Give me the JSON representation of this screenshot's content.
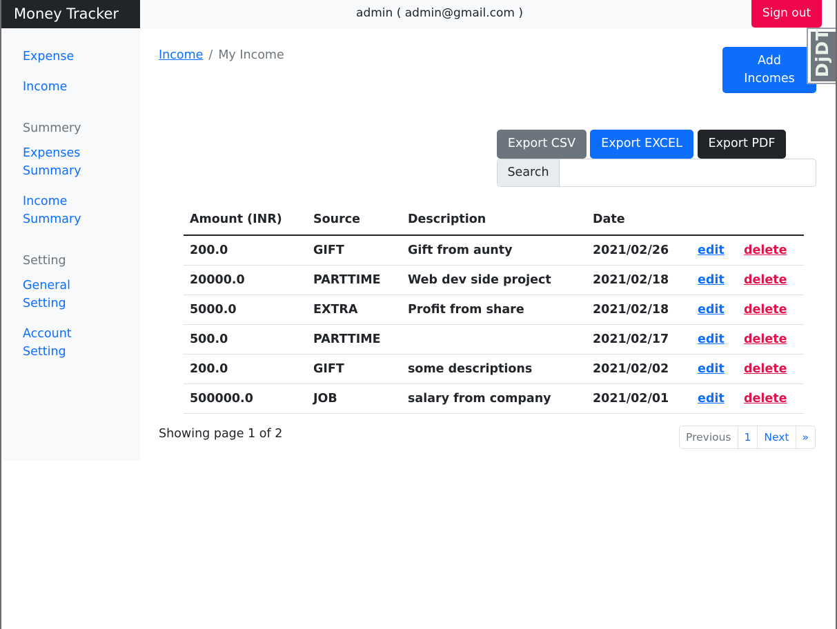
{
  "app": {
    "brand": "Money Tracker"
  },
  "header": {
    "user": "admin ( admin@gmail.com )",
    "signout_label": "Sign out"
  },
  "sidebar": {
    "expense": "Expense",
    "income": "Income",
    "summery_heading": "Summery",
    "expenses_summary_line1": "Expenses",
    "expenses_summary_line2": "Summary",
    "income_summary_line1": "Income",
    "income_summary_line2": "Summary",
    "setting_heading": "Setting",
    "general_setting_line1": "General",
    "general_setting_line2": "Setting",
    "account_setting_line1": "Account",
    "account_setting_line2": "Setting"
  },
  "breadcrumb": {
    "link": "Income",
    "separator": "/",
    "current": "My Income"
  },
  "toolbar": {
    "add_line1": "Add",
    "add_line2": "Incomes",
    "export_csv": "Export CSV",
    "export_excel": "Export EXCEL",
    "export_pdf": "Export PDF"
  },
  "search": {
    "label": "Search",
    "value": "",
    "placeholder": ""
  },
  "table": {
    "headers": [
      "Amount (INR)",
      "Source",
      "Description",
      "Date"
    ],
    "edit_label": "edit",
    "delete_label": "delete",
    "rows": [
      {
        "amount": "200.0",
        "source": "GIFT",
        "description": "Gift from aunty",
        "date": "2021/02/26"
      },
      {
        "amount": "20000.0",
        "source": "PARTTIME",
        "description": "Web dev side project",
        "date": "2021/02/18"
      },
      {
        "amount": "5000.0",
        "source": "EXTRA",
        "description": "Profit from share",
        "date": "2021/02/18"
      },
      {
        "amount": "500.0",
        "source": "PARTTIME",
        "description": "",
        "date": "2021/02/17"
      },
      {
        "amount": "200.0",
        "source": "GIFT",
        "description": "some descriptions",
        "date": "2021/02/02"
      },
      {
        "amount": "500000.0",
        "source": "JOB",
        "description": "salary from company",
        "date": "2021/02/01"
      }
    ]
  },
  "pagination": {
    "status": "Showing page 1 of 2",
    "previous": "Previous",
    "page": "1",
    "next": "Next",
    "last": "»"
  },
  "debug_toolbar": {
    "label": "DjDT"
  },
  "colors": {
    "primary": "#0d6efd",
    "danger": "#f0064a",
    "dark": "#212529",
    "secondary": "#6c757d"
  }
}
